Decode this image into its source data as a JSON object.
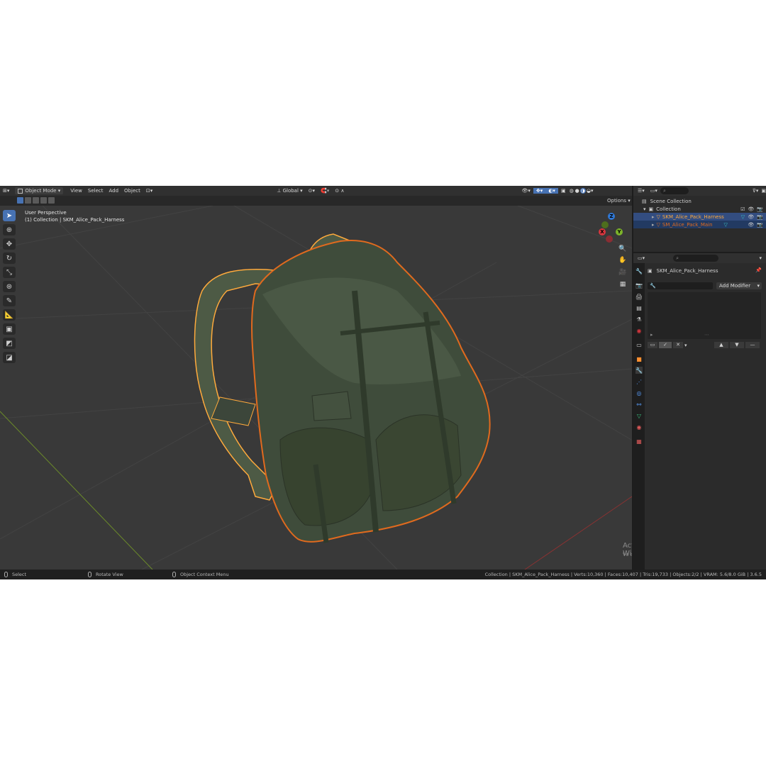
{
  "header": {
    "mode": "Object Mode",
    "menus": [
      "View",
      "Select",
      "Add",
      "Object"
    ],
    "orientation": "Global",
    "options_label": "Options"
  },
  "viewport": {
    "perspective": "User Perspective",
    "collection_info": "(1) Collection | SKM_Alice_Pack_Harness",
    "gizmo_axes": [
      "Z",
      "Y",
      "X"
    ],
    "watermark_title": "Activar Windows",
    "watermark_sub": "Ve a Configuración para activar Windows."
  },
  "toolbar_icons": [
    "select-box-icon",
    "cursor-icon",
    "move-icon",
    "rotate-icon",
    "scale-icon",
    "transform-icon",
    "annotate-icon",
    "measure-icon",
    "add-cube-icon",
    "add-plane-icon",
    "add-image-icon"
  ],
  "outliner": {
    "scene_collection": "Scene Collection",
    "collection": "Collection",
    "objects": [
      "SKM_Alice_Pack_Harness",
      "SM_Alice_Pack_Main"
    ]
  },
  "properties": {
    "object_name": "SKM_Alice_Pack_Harness",
    "add_modifier": "Add Modifier"
  },
  "statusbar": {
    "left_select": "Select",
    "rotate_view": "Rotate View",
    "context_menu": "Object Context Menu",
    "stats": "Collection | SKM_Alice_Pack_Harness | Verts:10,360 | Faces:10,407 | Tris:19,733 | Objects:2/2 | VRAM: 5.6/8.0 GiB | 3.6.5"
  },
  "colors": {
    "selection_active": "#ffaa3c",
    "selection": "#e06a1e",
    "header_bg": "#303030",
    "viewport_bg": "#393939",
    "accent": "#4772b3"
  }
}
